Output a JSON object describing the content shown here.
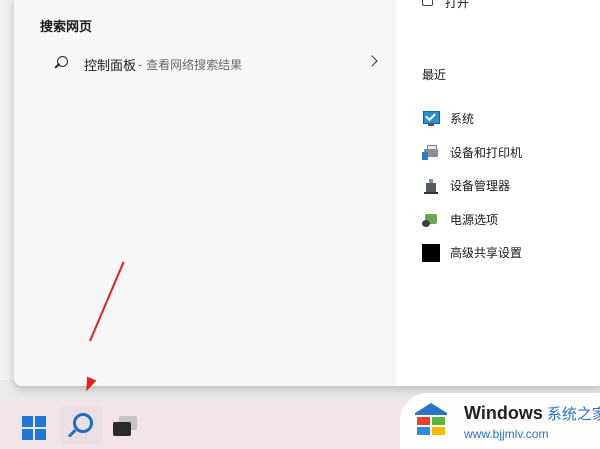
{
  "search_panel": {
    "section_title": "搜索网页",
    "result": {
      "main": "控制面板",
      "sub": " - 查看网络搜索结果"
    }
  },
  "right_panel": {
    "open_label": "打开",
    "recent_title": "最近",
    "recent_items": [
      {
        "label": "系统",
        "icon": "system-monitor-icon"
      },
      {
        "label": "设备和打印机",
        "icon": "printer-icon"
      },
      {
        "label": "设备管理器",
        "icon": "device-manager-icon"
      },
      {
        "label": "电源选项",
        "icon": "power-options-icon"
      },
      {
        "label": "高级共享设置",
        "icon": "sharing-icon"
      }
    ]
  },
  "annotation": {
    "arrow_color": "#e0201c"
  },
  "watermark": {
    "brand": "Windows",
    "brand_cn": "系统之家",
    "url": "www.bjjmlv.com"
  },
  "colors": {
    "taskbar": "#f3e4ea",
    "accent": "#1f78d6"
  }
}
